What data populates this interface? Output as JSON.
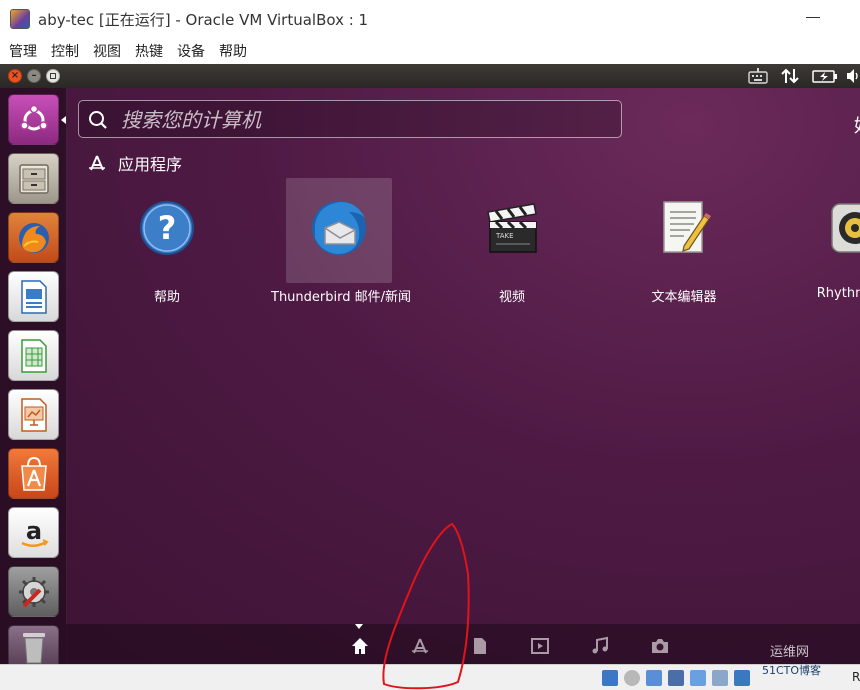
{
  "window": {
    "title": "aby-tec [正在运行] - Oracle VM VirtualBox : 1"
  },
  "menubar": {
    "items": [
      "管理",
      "控制",
      "视图",
      "热键",
      "设备",
      "帮助"
    ]
  },
  "launcher": {
    "items": [
      "ubuntu-dash-icon",
      "files-icon",
      "firefox-icon",
      "writer-icon",
      "calc-icon",
      "impress-icon",
      "software-center-icon",
      "amazon-icon",
      "system-settings-icon",
      "trash-icon"
    ]
  },
  "dash": {
    "search_placeholder": "搜索您的计算机",
    "filter_label_partial": "好",
    "category": "应用程序",
    "apps": [
      {
        "label": "帮助",
        "icon": "help-icon"
      },
      {
        "label": "Thunderbird 邮件/新闻",
        "icon": "thunderbird-icon",
        "active": true
      },
      {
        "label": "视频",
        "icon": "video-icon"
      },
      {
        "label": "文本编辑器",
        "icon": "text-editor-icon"
      },
      {
        "label": "Rhythmbox",
        "icon": "rhythmbox-icon"
      }
    ],
    "lenses": [
      "home-icon",
      "applications-icon",
      "files-icon",
      "video-icon",
      "music-icon",
      "photo-icon"
    ]
  },
  "statusbar": {
    "host_key": "R"
  },
  "watermark": {
    "line1": "运维网",
    "line2": "51CTO博客"
  },
  "colors": {
    "ubuntu_orange": "#e95420",
    "dash_purple": "#4e1a44",
    "annotation_red": "#e0141a"
  }
}
